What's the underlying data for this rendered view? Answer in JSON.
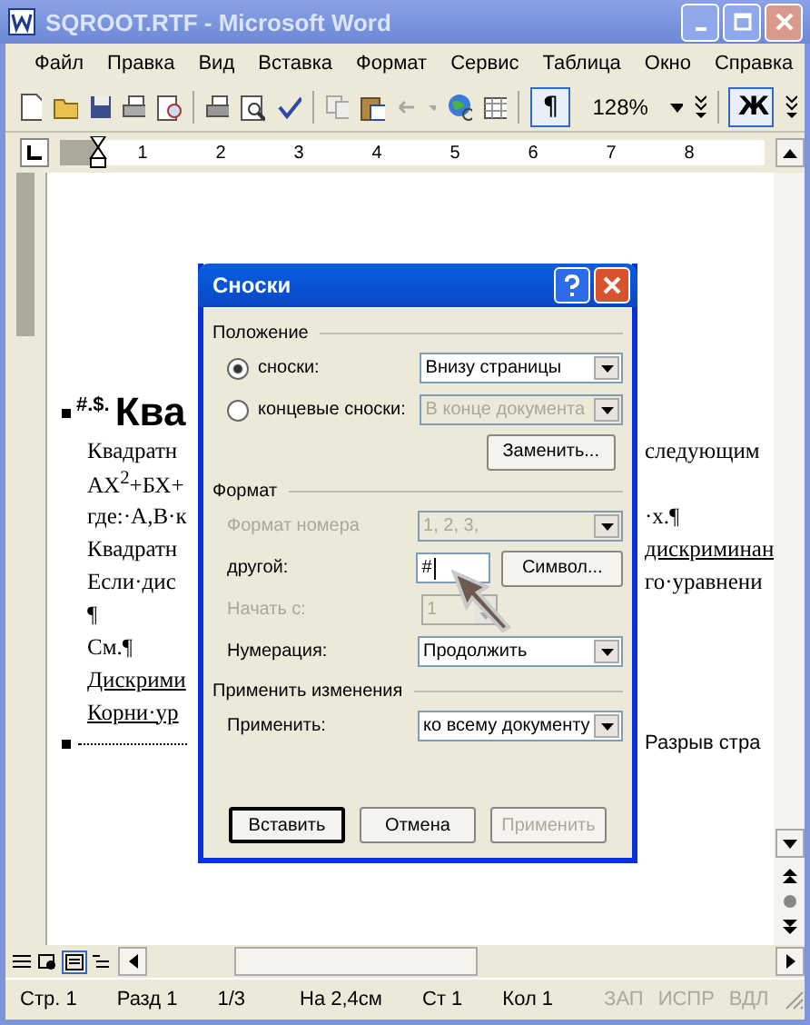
{
  "window": {
    "title": "SQROOT.RTF - Microsoft Word"
  },
  "menu": [
    "Файл",
    "Правка",
    "Вид",
    "Вставка",
    "Формат",
    "Сервис",
    "Таблица",
    "Окно",
    "Справка"
  ],
  "toolbar": {
    "pilcrow": {
      "label": "¶",
      "on": true
    },
    "zoom": "128%",
    "bold": {
      "label": "Ж",
      "on": true
    }
  },
  "ruler": [
    "1",
    "2",
    "3",
    "4",
    "5",
    "6",
    "7",
    "8"
  ],
  "document": {
    "heading": {
      "marks": "#.$.",
      "text": "Ква"
    },
    "lines": [
      {
        "left": {
          "text": "Квадратн",
          "underlined": false
        },
        "right": {
          "text": "следующим",
          "underlined": false
        }
      },
      {
        "left": {
          "text": "АХ$^{2}$+БХ+",
          "underlined": false
        }
      },
      {
        "left": {
          "text": "где:·А,В·к",
          "underlined": false
        },
        "right": {
          "text": "·х.¶",
          "underlined": false
        }
      },
      {
        "left": {
          "text": "Квадратн",
          "underlined": false
        },
        "right": {
          "text": "дискриминан",
          "underlined": true
        }
      },
      {
        "left": {
          "text": "Если·дис",
          "underlined": false
        },
        "right": {
          "text": "го·уравнени",
          "underlined": false
        }
      },
      {
        "left": {
          "text": "¶",
          "underlined": false
        }
      },
      {
        "left": {
          "text": "См.¶",
          "underlined": false
        }
      },
      {
        "left": {
          "text": "Дискрими",
          "underlined": true
        }
      },
      {
        "left": {
          "text": "Корни·ур",
          "underlined": true
        }
      }
    ],
    "page_break": "Разрыв стра"
  },
  "dialog": {
    "title": "Сноски",
    "position": {
      "title": "Положение",
      "options": [
        {
          "label": "сноски:",
          "selected": true,
          "value": "Внизу страницы",
          "disabled": false
        },
        {
          "label": "концевые сноски:",
          "selected": false,
          "value": "В конце документа",
          "disabled": true
        }
      ],
      "replace_button": "Заменить..."
    },
    "format": {
      "title": "Формат",
      "rows": [
        {
          "kind": "dropdown",
          "label": "Формат номера",
          "value": "1, 2, 3,",
          "disabled": true
        },
        {
          "kind": "text",
          "label": "другой:",
          "value": "#",
          "button": "Символ...",
          "disabled": false
        },
        {
          "kind": "spinner",
          "label": "Начать с:",
          "value": "1",
          "disabled": true
        },
        {
          "kind": "dropdown",
          "label": "Нумерация:",
          "value": "Продолжить",
          "disabled": false
        }
      ]
    },
    "apply": {
      "title": "Применить изменения",
      "label": "Применить:",
      "value": "ко всему документу"
    },
    "buttons": [
      {
        "label": "Вставить",
        "default": true,
        "disabled": false
      },
      {
        "label": "Отмена",
        "default": false,
        "disabled": false
      },
      {
        "label": "Применить",
        "default": false,
        "disabled": true
      }
    ]
  },
  "status_bar": [
    {
      "text": "Стр. 1",
      "disabled": false
    },
    {
      "text": "Разд 1",
      "disabled": false
    },
    {
      "text": "1/3",
      "disabled": false
    },
    {
      "text": "На 2,4см",
      "disabled": false
    },
    {
      "text": "Ст 1",
      "disabled": false
    },
    {
      "text": "Кол 1",
      "disabled": false
    },
    {
      "text": "ЗАП",
      "disabled": true
    },
    {
      "text": "ИСПР",
      "disabled": true
    },
    {
      "text": "ВДЛ",
      "disabled": true
    }
  ]
}
